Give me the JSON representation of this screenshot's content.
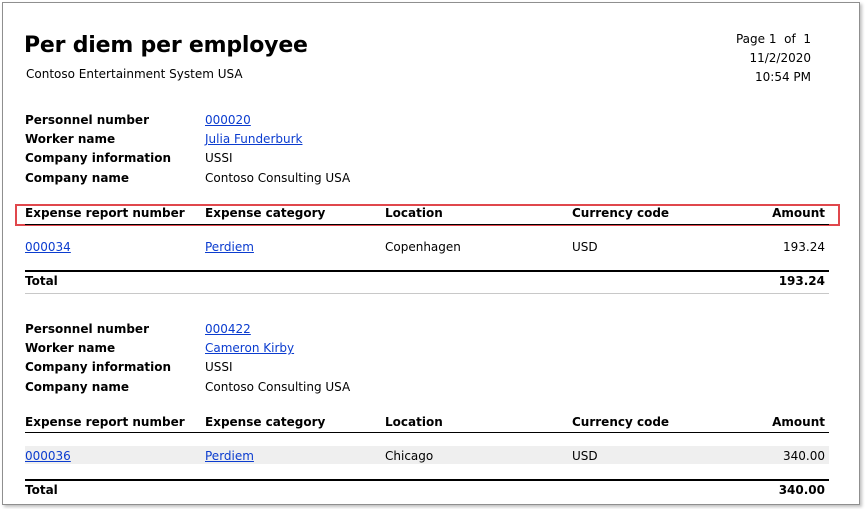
{
  "report": {
    "title": "Per diem per employee",
    "company": "Contoso Entertainment System USA",
    "page_label": "Page",
    "page_number": "1",
    "page_of": "of",
    "page_total": "1",
    "date": "11/2/2020",
    "time": "10:54 PM"
  },
  "labels": {
    "personnel_number": "Personnel number",
    "worker_name": "Worker name",
    "company_information": "Company information",
    "company_name": "Company name",
    "total": "Total"
  },
  "columns": {
    "expense_report_number": "Expense report number",
    "expense_category": "Expense category",
    "location": "Location",
    "currency_code": "Currency code",
    "amount": "Amount"
  },
  "groups": [
    {
      "personnel_number": "000020",
      "worker_name": "Julia Funderburk",
      "company_information": "USSI",
      "company_name": "Contoso Consulting USA",
      "rows": [
        {
          "expense_report_number": "000034",
          "expense_category": "Perdiem",
          "location": "Copenhagen",
          "currency_code": "USD",
          "amount": "193.24"
        }
      ],
      "total": "193.24"
    },
    {
      "personnel_number": "000422",
      "worker_name": "Cameron Kirby",
      "company_information": "USSI",
      "company_name": "Contoso Consulting USA",
      "rows": [
        {
          "expense_report_number": "000036",
          "expense_category": "Perdiem",
          "location": "Chicago",
          "currency_code": "USD",
          "amount": "340.00"
        }
      ],
      "total": "340.00"
    }
  ],
  "colors": {
    "link": "#0b3ccf",
    "highlight_box": "#e0474c",
    "row_shading": "#efefef"
  }
}
